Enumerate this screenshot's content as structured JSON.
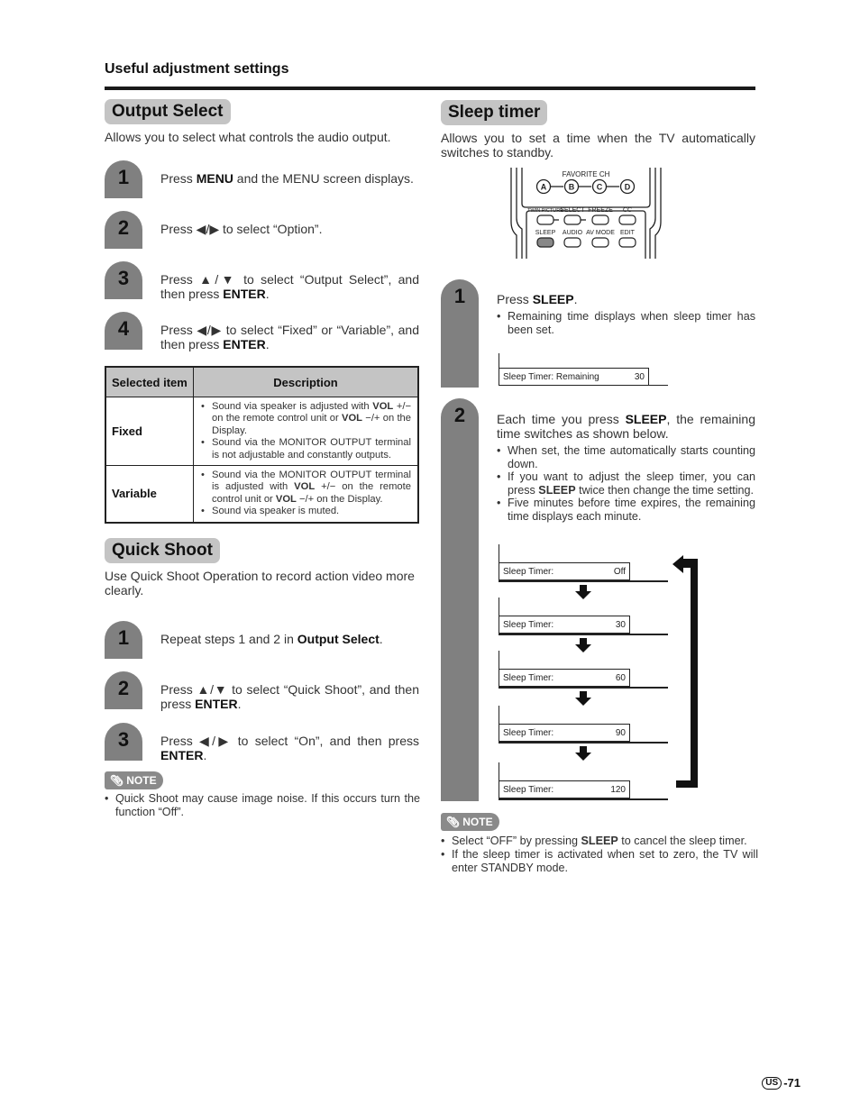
{
  "page": {
    "section_label": "Useful adjustment settings",
    "page_region": "US",
    "page_number": "-71"
  },
  "output_select": {
    "title": "Output Select",
    "intro": "Allows you to select what controls the audio output.",
    "steps": [
      {
        "num": "1",
        "html": "Press <b>MENU</b> and the MENU screen displays."
      },
      {
        "num": "2",
        "html": "Press ◀/▶ to select “Option”."
      },
      {
        "num": "3",
        "html": "Press ▲/▼ to select “Output Select”, and then press <b>ENTER</b>."
      },
      {
        "num": "4",
        "html": "Press ◀/▶ to select “Fixed” or “Variable”, and then press <b>ENTER</b>."
      }
    ],
    "table": {
      "headers": [
        "Selected item",
        "Description"
      ],
      "rows": [
        {
          "item": "Fixed",
          "bullets": [
            "Sound via speaker is adjusted with <b>VOL</b> +/− on the remote control unit or <b>VOL</b> −/+ on the Display.",
            "Sound via the MONITOR OUTPUT terminal is not adjustable and constantly outputs."
          ]
        },
        {
          "item": "Variable",
          "bullets": [
            "Sound via the MONITOR OUTPUT terminal is adjusted with <b>VOL</b> +/− on the remote control unit or <b>VOL</b> −/+ on the Display.",
            "Sound via speaker is muted."
          ]
        }
      ]
    }
  },
  "quick_shoot": {
    "title": "Quick Shoot",
    "intro": "Use Quick Shoot Operation to record action video more clearly.",
    "steps": [
      {
        "num": "1",
        "html": "Repeat steps 1 and 2 in <b>Output Select</b>."
      },
      {
        "num": "2",
        "html": "Press ▲/▼ to select “Quick Shoot”, and then press <b>ENTER</b>."
      },
      {
        "num": "3",
        "html": "Press ◀/▶ to select “On”, and then press <b>ENTER</b>."
      }
    ],
    "note_label": "NOTE",
    "notes": [
      "Quick Shoot may cause image noise. If this occurs turn the function “Off”."
    ]
  },
  "sleep_timer": {
    "title": "Sleep timer",
    "intro": "Allows you to set a time when the TV automatically switches to standby.",
    "remote": {
      "favorite_label": "FAVORITE CH",
      "favorite_buttons": [
        "A",
        "B",
        "C",
        "D"
      ],
      "row1_labels": [
        "TWIN PICTURE",
        "SELECT",
        "FREEZE",
        "CC"
      ],
      "row2_labels": [
        "SLEEP",
        "AUDIO",
        "AV MODE",
        "EDIT"
      ],
      "highlighted": "SLEEP"
    },
    "step1": {
      "num": "1",
      "html": "Press <b>SLEEP</b>.",
      "bullets": [
        "Remaining time displays when sleep timer has been set."
      ],
      "osd": {
        "label": "Sleep Timer: Remaining",
        "value": "30"
      }
    },
    "step2": {
      "num": "2",
      "html": "Each time you press <b>SLEEP</b>, the remaining time switches as shown below.",
      "bullets": [
        "When set, the time automatically starts counting down.",
        "If you want to adjust the sleep timer, you can press <b>SLEEP</b> twice then change the time setting.",
        "Five minutes before time expires, the remaining time displays each minute."
      ],
      "cycle": [
        {
          "label": "Sleep Timer:",
          "value": "Off"
        },
        {
          "label": "Sleep Timer:",
          "value": "30"
        },
        {
          "label": "Sleep Timer:",
          "value": "60"
        },
        {
          "label": "Sleep Timer:",
          "value": "90"
        },
        {
          "label": "Sleep Timer:",
          "value": "120"
        }
      ]
    },
    "note_label": "NOTE",
    "notes": [
      "Select “OFF” by pressing <b>SLEEP</b> to cancel the sleep timer.",
      "If the sleep timer is activated when set to zero, the TV will enter STANDBY mode."
    ]
  }
}
